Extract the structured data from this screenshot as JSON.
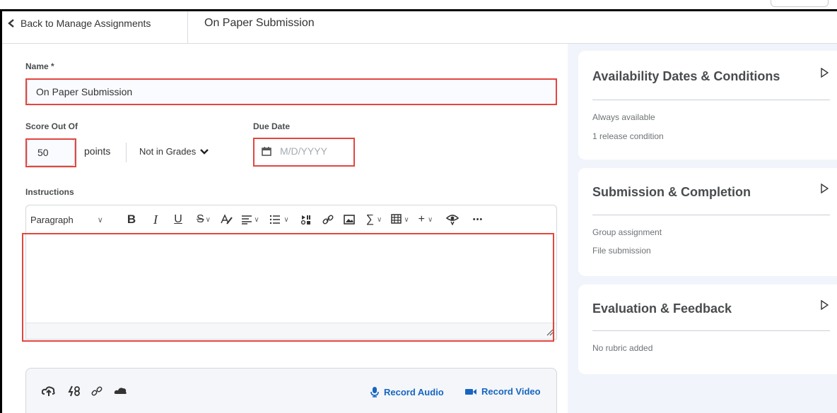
{
  "header": {
    "back_label": "Back to Manage Assignments",
    "title": "On Paper Submission"
  },
  "form": {
    "name_label": "Name *",
    "name_value": "On Paper Submission",
    "score_label": "Score Out Of",
    "score_value": "50",
    "points_label": "points",
    "grades_label": "Not in Grades",
    "due_label": "Due Date",
    "due_placeholder": "M/D/YYYY",
    "instructions_label": "Instructions",
    "paragraph_label": "Paragraph"
  },
  "toolbar": {
    "bold": "B",
    "italic": "I",
    "underline": "U",
    "strike": "S",
    "more": "•••",
    "sigma": "∑",
    "plus": "+"
  },
  "attach": {
    "record_audio": "Record Audio",
    "record_video": "Record Video"
  },
  "panels": [
    {
      "title": "Availability Dates & Conditions",
      "lines": [
        "Always available",
        "1 release condition"
      ]
    },
    {
      "title": "Submission & Completion",
      "lines": [
        "Group assignment",
        "File submission"
      ]
    },
    {
      "title": "Evaluation & Feedback",
      "lines": [
        "No rubric added"
      ]
    }
  ],
  "colors": {
    "highlight": "#e2463f",
    "link": "#1665c1",
    "panel_bg": "#f1f5fb"
  }
}
